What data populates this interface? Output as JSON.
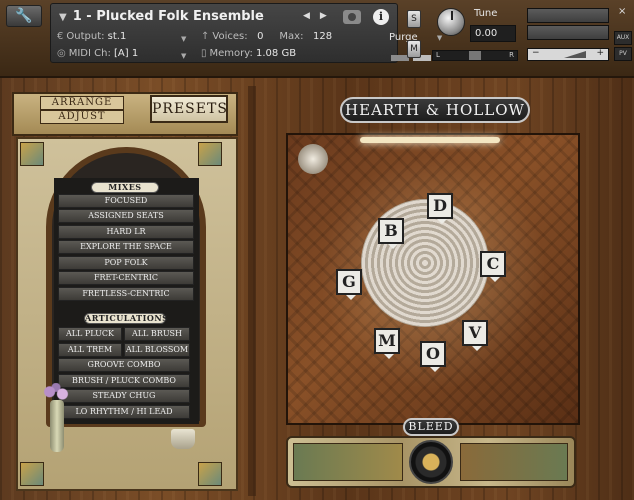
{
  "header": {
    "instrument_name": "1 - Plucked Folk Ensemble",
    "output_label": "Output:",
    "output_value": "st.1",
    "voices_label": "Voices:",
    "voices_value": "0",
    "max_label": "Max:",
    "max_value": "128",
    "purge_label": "Purge",
    "midi_label": "MIDI Ch:",
    "midi_value": "[A] 1",
    "memory_label": "Memory:",
    "memory_value": "1.08 GB",
    "solo_label": "S",
    "mute_label": "M",
    "tune_label": "Tune",
    "tune_value": "0.00",
    "pan_left": "L",
    "pan_right": "R",
    "vol_minus": "−",
    "vol_plus": "+",
    "aux_label": "AUX",
    "pv_label": "PV",
    "close_label": "×"
  },
  "tabs": {
    "arrange": "ARRANGE",
    "adjust": "ADJUST",
    "presets": "PRESETS"
  },
  "mixes": {
    "header": "MIXES",
    "items": [
      "FOCUSED",
      "ASSIGNED SEATS",
      "HARD LR",
      "EXPLORE THE SPACE",
      "POP FOLK",
      "FRET-CENTRIC",
      "FRETLESS-CENTRIC"
    ]
  },
  "articulations": {
    "header": "ARTICULATIONS",
    "pairs": [
      [
        "ALL PLUCK",
        "ALL BRUSH"
      ],
      [
        "ALL TREM",
        "ALL BLOSSOM"
      ]
    ],
    "items": [
      "GROOVE COMBO",
      "BRUSH / PLUCK COMBO",
      "STEADY CHUG",
      "LO RHYTHM / HI LEAD"
    ]
  },
  "brand": "HEARTH & HOLLOW",
  "players": [
    "D",
    "B",
    "C",
    "G",
    "V",
    "M",
    "O"
  ],
  "bleed_label": "BLEED"
}
